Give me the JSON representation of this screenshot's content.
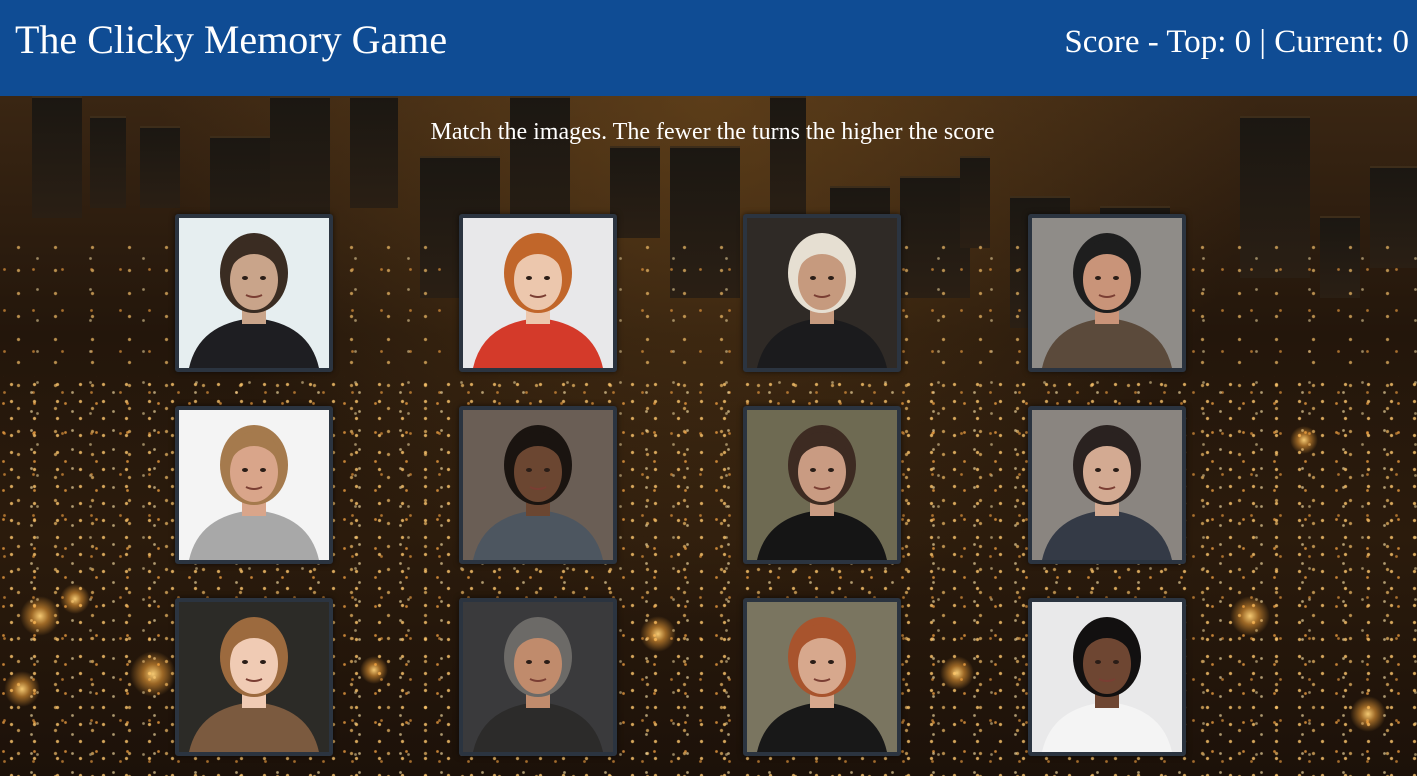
{
  "header": {
    "title": "The Clicky Memory Game",
    "score_text": "Score - Top: 0 | Current: 0"
  },
  "instructions": "Match the images. The fewer the turns the higher the score",
  "colors": {
    "navbar": "#0f4c94",
    "text": "#ffffff",
    "card_border": "#2b3440"
  },
  "cards": [
    {
      "id": "card-1",
      "icon": "portrait-man-dark-suit-crouching",
      "bg": "#e6eef0",
      "skin": "#c9a48a",
      "hair": "#3a2c22",
      "shirt": "#1e1e22"
    },
    {
      "id": "card-2",
      "icon": "portrait-woman-red-hair",
      "bg": "#e8e8ea",
      "skin": "#ecc7ad",
      "hair": "#c1662a",
      "shirt": "#d43a2a"
    },
    {
      "id": "card-3",
      "icon": "portrait-older-man-white-hair",
      "bg": "#2f2a26",
      "skin": "#c69a7e",
      "hair": "#e6dfd2",
      "shirt": "#1b1b1d"
    },
    {
      "id": "card-4",
      "icon": "portrait-man-beanie-phone",
      "bg": "#8f8c88",
      "skin": "#c99479",
      "hair": "#1e1e1e",
      "shirt": "#5b4a3b"
    },
    {
      "id": "card-5",
      "icon": "portrait-man-fite-club-shirt",
      "bg": "#f4f4f4",
      "skin": "#d9a58a",
      "hair": "#a57a4d",
      "shirt": "#a8a8a8"
    },
    {
      "id": "card-6",
      "icon": "portrait-man-hoodie-headphones",
      "bg": "#6a5e55",
      "skin": "#6b4631",
      "hair": "#1a1410",
      "shirt": "#4d5660"
    },
    {
      "id": "card-7",
      "icon": "portrait-woman-sunglasses",
      "bg": "#6e6a52",
      "skin": "#c99b82",
      "hair": "#3d2b22",
      "shirt": "#151515"
    },
    {
      "id": "card-8",
      "icon": "portrait-man-doorway",
      "bg": "#8a8580",
      "skin": "#d3aa92",
      "hair": "#2a2220",
      "shirt": "#343a46"
    },
    {
      "id": "card-9",
      "icon": "portrait-girl-long-hair",
      "bg": "#2c2b27",
      "skin": "#f0cbb4",
      "hair": "#9c6a3e",
      "shirt": "#7b5a3f"
    },
    {
      "id": "card-10",
      "icon": "portrait-man-smiling-gray-hair",
      "bg": "#3a3a3c",
      "skin": "#c08b6c",
      "hair": "#6c6a67",
      "shirt": "#2c2b2a"
    },
    {
      "id": "card-11",
      "icon": "portrait-woman-wine-glass",
      "bg": "#7a7560",
      "skin": "#d7a88d",
      "hair": "#a8542d",
      "shirt": "#181818"
    },
    {
      "id": "card-12",
      "icon": "portrait-woman-black-hair",
      "bg": "#e9e9ea",
      "skin": "#6e4632",
      "hair": "#121010",
      "shirt": "#f4f4f4"
    }
  ]
}
